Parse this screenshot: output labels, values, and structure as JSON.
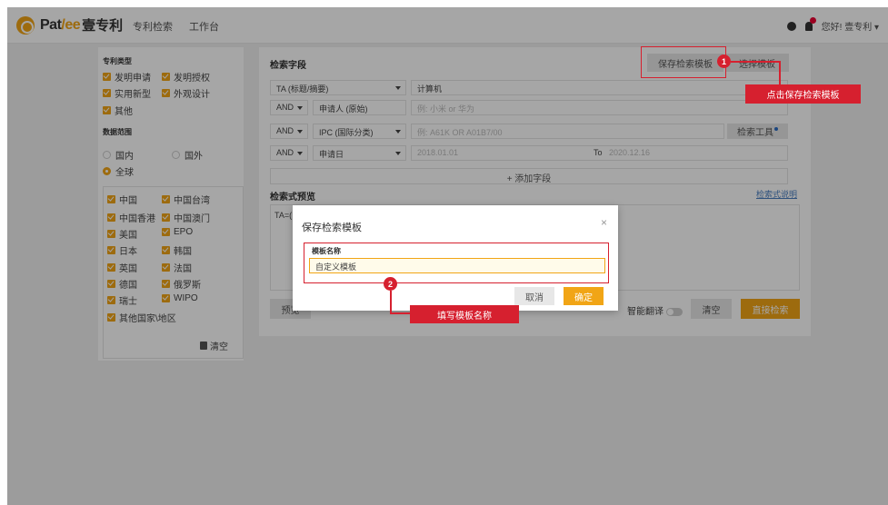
{
  "header": {
    "brand_latin": "Pat",
    "brand_y": "/ee",
    "brand_cn": "壹专利",
    "nav": [
      "专利检索",
      "工作台"
    ],
    "greeting": "您好! 壹专利 ▾"
  },
  "left": {
    "patent_type_title": "专利类型",
    "patent_types": [
      "发明申请",
      "发明授权",
      "实用新型",
      "外观设计",
      "其他"
    ],
    "scope_title": "数据范围",
    "scopes": [
      "国内",
      "国外",
      "全球"
    ],
    "countries": [
      "中国",
      "中国台湾",
      "中国香港",
      "中国澳门",
      "美国",
      "EPO",
      "日本",
      "韩国",
      "英国",
      "法国",
      "德国",
      "俄罗斯",
      "瑞士",
      "WIPO",
      "其他国家\\地区"
    ],
    "clear_label": "清空"
  },
  "main": {
    "fields_title": "检索字段",
    "save_template_btn": "保存检索模板",
    "select_template_btn": "选择模板",
    "rows": [
      {
        "op": "",
        "field": "TA (标题/摘要)",
        "value": "计算机",
        "placeholder": false
      },
      {
        "op": "AND",
        "field": "申请人 (原始)",
        "value": "例: 小米 or 华为",
        "placeholder": true
      },
      {
        "op": "AND",
        "field": "IPC (国际分类)",
        "value": "例: A61K OR A01B7/00",
        "placeholder": true
      },
      {
        "op": "AND",
        "field": "申请日",
        "value": "2018.01.01",
        "placeholder": true
      }
    ],
    "to_label": "To",
    "to_value": "2020.12.16",
    "search_tool_btn": "检索工具",
    "add_field": "+ 添加字段",
    "preview_title": "检索式预览",
    "preview_help": "检索式说明",
    "preview_text": "TA=(",
    "preview_btn": "预览",
    "smart_translate": "智能翻译",
    "clear_btn": "清空",
    "search_btn": "直接检索"
  },
  "dialog": {
    "title": "保存检索模板",
    "close": "×",
    "name_label": "模板名称",
    "name_value": "自定义模板",
    "cancel": "取消",
    "confirm": "确定"
  },
  "annotations": {
    "step1": "1",
    "step1_text": "点击保存检索模板",
    "step2": "2",
    "step2_text": "填写模板名称"
  },
  "colors": {
    "accent": "#f1a516",
    "annotation": "#d6202f",
    "link": "#4a7fc1"
  }
}
